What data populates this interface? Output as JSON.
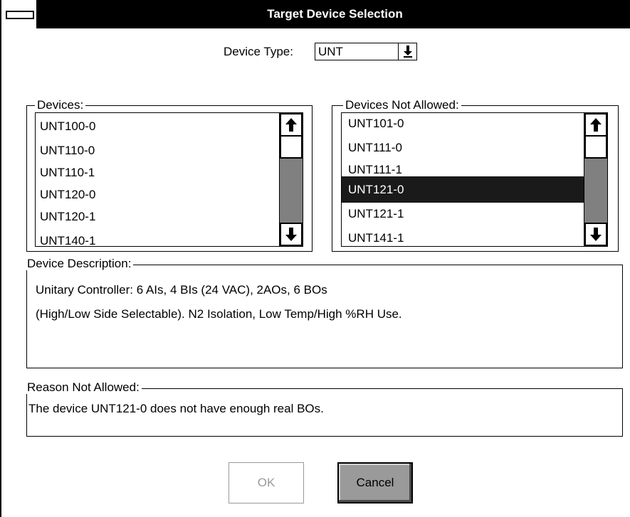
{
  "window": {
    "title": "Target Device Selection"
  },
  "device_type": {
    "label": "Device Type:",
    "value": "UNT"
  },
  "devices": {
    "label": "Devices:",
    "items": [
      "UNT100-0",
      "UNT110-0",
      "UNT110-1",
      "UNT120-0",
      "UNT120-1",
      "UNT140-1"
    ]
  },
  "devices_not_allowed": {
    "label": "Devices Not Allowed:",
    "items": [
      "UNT101-0",
      "UNT111-0",
      "UNT111-1",
      "UNT121-0",
      "UNT121-1",
      "UNT141-1"
    ],
    "selected": "UNT121-0"
  },
  "device_description": {
    "label": "Device Description:",
    "lines": [
      "Unitary Controller: 6 AIs, 4 BIs (24 VAC), 2AOs, 6 BOs",
      "(High/Low Side Selectable).  N2 Isolation, Low Temp/High %RH Use."
    ]
  },
  "reason_not_allowed": {
    "label": "Reason Not Allowed:",
    "text": "The device UNT121-0 does not have enough real BOs."
  },
  "buttons": {
    "ok": "OK",
    "cancel": "Cancel"
  },
  "icons": {
    "system_menu": "system-menu-icon",
    "dropdown": "dropdown-arrow-icon",
    "scroll_up": "arrow-up-icon",
    "scroll_down": "arrow-down-icon"
  }
}
